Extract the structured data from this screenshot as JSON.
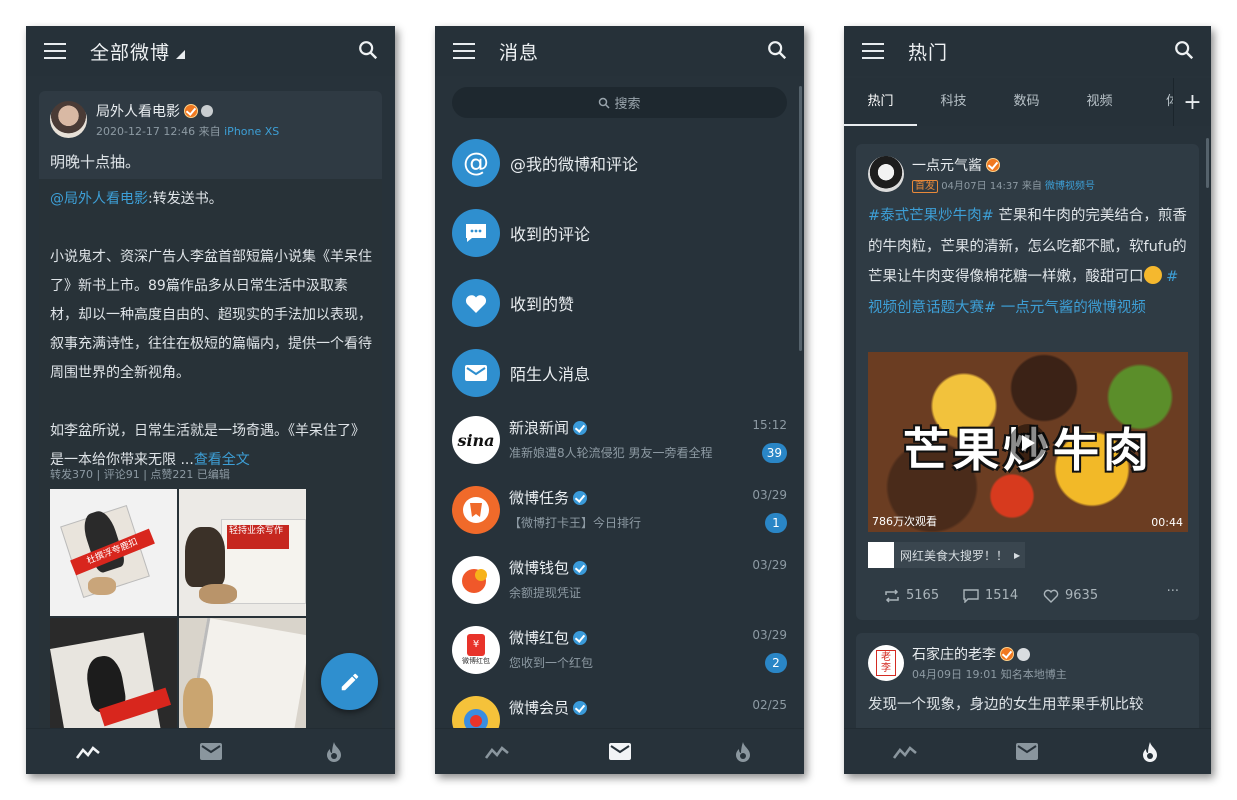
{
  "phone1": {
    "title": "全部微博",
    "post": {
      "author": "局外人看电影",
      "time": "2020-12-17 12:46",
      "from_prefix": "来自",
      "from_device": "iPhone XS",
      "text": "明晚十点抽。",
      "quote_author": "@局外人看电影",
      "quote_suffix": ":转发送书。",
      "quote_p1": "小说鬼才、资深广告人李盆首部短篇小说集《羊呆住了》新书上市。89篇作品多从日常生活中汲取素材，却以一种高度自由的、超现实的手法加以表现，叙事充满诗性，往往在极短的篇幅内，提供一个看待周围世界的全新视角。",
      "quote_p2": "如李盆所说，日常生活就是一场奇遇。《羊呆住了》是一本给你带来无限 ...",
      "read_more": "查看全文",
      "stats": "转发370 | 评论91 | 点赞221  已编辑",
      "image_text_1": "杜撰浮夸鹿扣",
      "image_text_2": "轻持业余写作"
    }
  },
  "phone2": {
    "title": "消息",
    "search_placeholder": "搜索",
    "menu": [
      {
        "label": "@我的微博和评论"
      },
      {
        "label": "收到的评论"
      },
      {
        "label": "收到的赞"
      },
      {
        "label": "陌生人消息"
      }
    ],
    "chats": [
      {
        "name": "新浪新闻",
        "preview": "准新娘遭8人轮流侵犯 男友一旁看全程",
        "time": "15:12",
        "badge": "39"
      },
      {
        "name": "微博任务",
        "preview": "【微博打卡王】今日排行",
        "time": "03/29",
        "badge": "1"
      },
      {
        "name": "微博钱包",
        "preview": "余额提现凭证",
        "time": "03/29",
        "badge": ""
      },
      {
        "name": "微博红包",
        "preview": "您收到一个红包",
        "time": "03/29",
        "badge": "2"
      },
      {
        "name": "微博会员",
        "preview": "",
        "time": "02/25",
        "badge": ""
      }
    ],
    "sina_logo_text": "sina",
    "hongbao_text": "微博红包"
  },
  "phone3": {
    "title": "热门",
    "tabs": [
      "热门",
      "科技",
      "数码",
      "视频",
      "体"
    ],
    "plus": "+",
    "post1": {
      "author": "一点元气酱",
      "tag": "首发",
      "time": "04月07日 14:37",
      "from_prefix": "来自",
      "from_source": "微博视频号",
      "hashtag1": "#泰式芒果炒牛肉#",
      "text1": " 芒果和牛肉的完美结合，煎香的牛肉粒，芒果的清新，怎么吃都不腻，软fufu的芒果让牛肉变得像棉花糖一样嫩，酸甜可口",
      "hashtag2": " #视频创意话题大赛#",
      "video_link": " 一点元气酱的微博视频",
      "video_title": "芒果炒牛肉",
      "views": "786万次观看",
      "duration": "00:44",
      "topic": "网红美食大搜罗！！",
      "reposts": "5165",
      "comments": "1514",
      "likes": "9635",
      "more": "···"
    },
    "post2": {
      "author": "石家庄的老李",
      "time": "04月09日 19:01",
      "desc": "知名本地博主",
      "text": "发现一个现象，身边的女生用苹果手机比较",
      "avatar_text": "老李"
    }
  },
  "colors": {
    "bg": "#27323a",
    "card": "#2f3a43",
    "accent": "#3d9fd6",
    "badge": "#2a86c6"
  }
}
